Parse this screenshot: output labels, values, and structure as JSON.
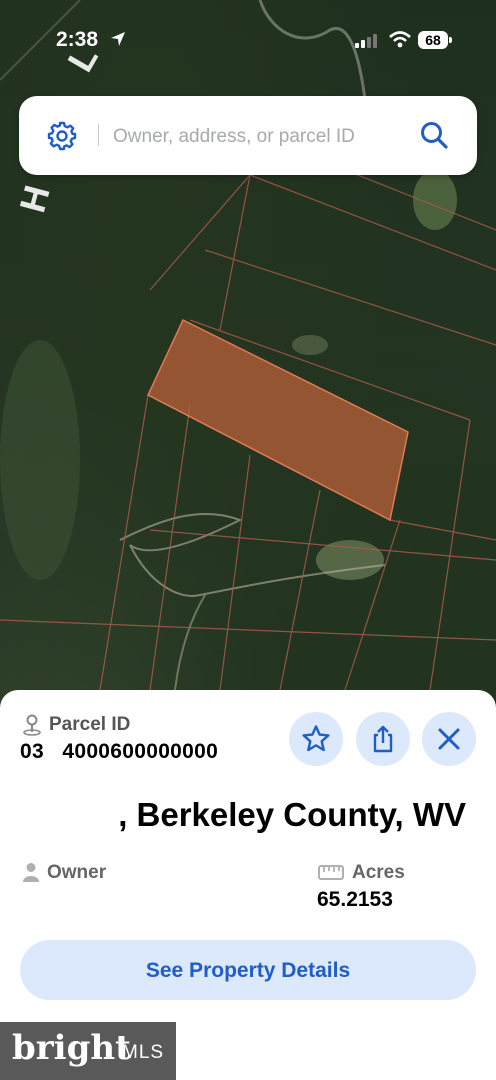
{
  "status_bar": {
    "time": "2:38",
    "battery": "68"
  },
  "map": {
    "street_labels": [
      "L",
      "H"
    ],
    "parcel_color": "#c1623a"
  },
  "search": {
    "placeholder": "Owner, address, or parcel ID"
  },
  "parcel": {
    "id_label": "Parcel ID",
    "id_value": "03   4000600000000",
    "address": ", Berkeley County, WV",
    "owner_label": "Owner",
    "owner_value": "",
    "acres_label": "Acres",
    "acres_value": "65.2153"
  },
  "actions": {
    "details_label": "See Property Details"
  },
  "watermark": {
    "brand": "bright",
    "suffix": "MLS"
  },
  "colors": {
    "accent": "#1f5dc9",
    "button_bg": "#dce8fb"
  },
  "icons": [
    "gear-icon",
    "search-icon",
    "location-pin-icon",
    "star-icon",
    "share-icon",
    "close-icon",
    "person-icon",
    "ruler-icon"
  ]
}
